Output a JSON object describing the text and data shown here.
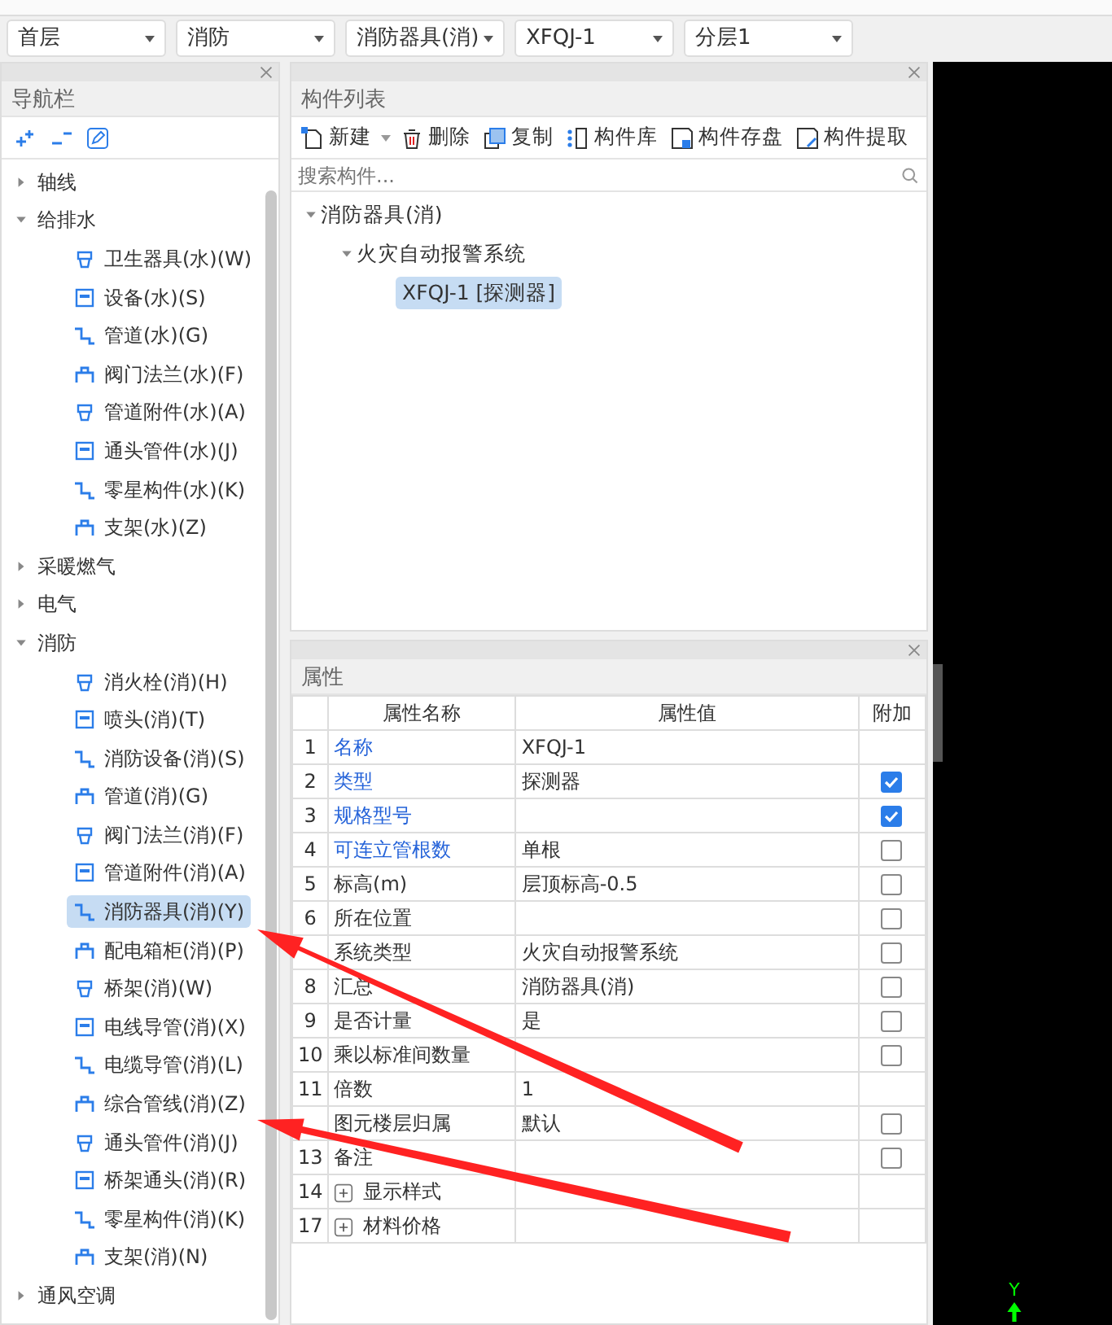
{
  "selectors": [
    "首层",
    "消防",
    "消防器具(消)",
    "XFQJ-1",
    "分层1"
  ],
  "nav": {
    "title": "导航栏",
    "tree": [
      {
        "label": "轴线",
        "expanded": false
      },
      {
        "label": "给排水",
        "expanded": true,
        "children": [
          {
            "label": "卫生器具(水)(W)",
            "selected": false
          },
          {
            "label": "设备(水)(S)",
            "selected": false
          },
          {
            "label": "管道(水)(G)",
            "selected": false
          },
          {
            "label": "阀门法兰(水)(F)",
            "selected": false
          },
          {
            "label": "管道附件(水)(A)",
            "selected": false
          },
          {
            "label": "通头管件(水)(J)",
            "selected": false
          },
          {
            "label": "零星构件(水)(K)",
            "selected": false
          },
          {
            "label": "支架(水)(Z)",
            "selected": false
          }
        ]
      },
      {
        "label": "采暖燃气",
        "expanded": false
      },
      {
        "label": "电气",
        "expanded": false
      },
      {
        "label": "消防",
        "expanded": true,
        "children": [
          {
            "label": "消火栓(消)(H)",
            "selected": false
          },
          {
            "label": "喷头(消)(T)",
            "selected": false
          },
          {
            "label": "消防设备(消)(S)",
            "selected": false
          },
          {
            "label": "管道(消)(G)",
            "selected": false
          },
          {
            "label": "阀门法兰(消)(F)",
            "selected": false
          },
          {
            "label": "管道附件(消)(A)",
            "selected": false
          },
          {
            "label": "消防器具(消)(Y)",
            "selected": true
          },
          {
            "label": "配电箱柜(消)(P)",
            "selected": false
          },
          {
            "label": "桥架(消)(W)",
            "selected": false
          },
          {
            "label": "电线导管(消)(X)",
            "selected": false
          },
          {
            "label": "电缆导管(消)(L)",
            "selected": false
          },
          {
            "label": "综合管线(消)(Z)",
            "selected": false
          },
          {
            "label": "通头管件(消)(J)",
            "selected": false
          },
          {
            "label": "桥架通头(消)(R)",
            "selected": false
          },
          {
            "label": "零星构件(消)(K)",
            "selected": false
          },
          {
            "label": "支架(消)(N)",
            "selected": false
          }
        ]
      },
      {
        "label": "通风空调",
        "expanded": false
      }
    ]
  },
  "component_list": {
    "title": "构件列表",
    "buttons": [
      "新建",
      "删除",
      "复制",
      "构件库",
      "构件存盘",
      "构件提取"
    ],
    "search": {
      "placeholder": "搜索构件..."
    },
    "tree": [
      {
        "label": "消防器具(消)",
        "expanded": true,
        "children": [
          {
            "label": "火灾自动报警系统",
            "expanded": true,
            "children": [
              {
                "label": "XFQJ-1 [探测器]",
                "selected": true
              }
            ]
          }
        ]
      }
    ]
  },
  "properties": {
    "title": "属性",
    "columns": [
      "属性名称",
      "属性值",
      "附加"
    ],
    "rows": [
      {
        "number": "1",
        "name": "名称",
        "value": "XFQJ-1",
        "kind": "field",
        "public": true
      },
      {
        "number": "2",
        "name": "类型",
        "value": "探测器",
        "kind": "field",
        "public": true,
        "attached": true
      },
      {
        "number": "3",
        "name": "规格型号",
        "kind": "field",
        "public": true,
        "attached": true
      },
      {
        "number": "4",
        "name": "可连立管根数",
        "value": "单根",
        "kind": "field",
        "public": true,
        "attached": false
      },
      {
        "number": "5",
        "name": "标高(m)",
        "value": "层顶标高-0.5",
        "kind": "field",
        "public": false,
        "attached": false
      },
      {
        "number": "6",
        "name": "所在位置",
        "kind": "field",
        "public": false,
        "attached": false
      },
      {
        "name": "系统类型",
        "value": "火灾自动报警系统",
        "kind": "field",
        "public": false,
        "attached": false
      },
      {
        "number": "8",
        "name": "汇总",
        "value": "消防器具(消)",
        "kind": "field",
        "public": false,
        "attached": false
      },
      {
        "number": "9",
        "name": "是否计量",
        "value": "是",
        "kind": "field",
        "public": false,
        "attached": false
      },
      {
        "number": "10",
        "name": "乘以标准间数量",
        "kind": "field",
        "public": false,
        "attached": false
      },
      {
        "number": "11",
        "name": "倍数",
        "value": "1",
        "kind": "field",
        "public": false
      },
      {
        "name": "图元楼层归属",
        "value": "默认",
        "kind": "field",
        "public": false,
        "attached": false
      },
      {
        "number": "13",
        "name": "备注",
        "kind": "field",
        "public": false,
        "attached": false
      },
      {
        "number": "14",
        "name": "显示样式",
        "kind": "group",
        "public": false
      },
      {
        "number": "17",
        "name": "材料价格",
        "kind": "group",
        "public": false
      }
    ]
  },
  "canvas": {
    "axis_label": "Y"
  }
}
